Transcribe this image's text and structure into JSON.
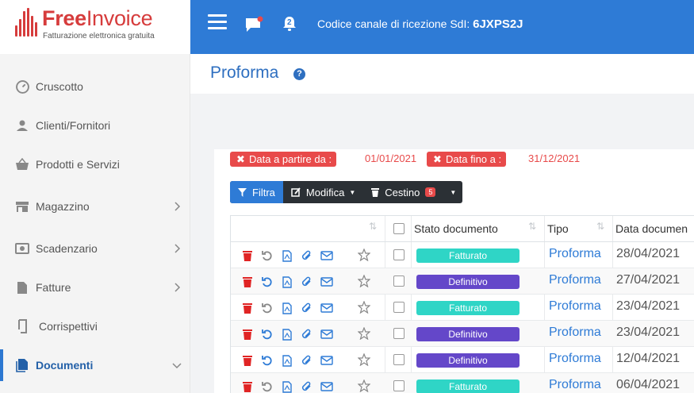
{
  "logo": {
    "brand_free": "Free",
    "brand_invoice": "Invoice",
    "tagline": "Fatturazione elettronica gratuita"
  },
  "topbar": {
    "channel_label": "Codice canale di ricezione SdI:",
    "channel_code": "6JXPS2J",
    "notification_count": "2"
  },
  "sidebar": {
    "items": [
      {
        "label": "Cruscotto",
        "icon": "dashboard-icon"
      },
      {
        "label": "Clienti/Fornitori",
        "icon": "user-icon"
      },
      {
        "label": "Prodotti e Servizi",
        "icon": "basket-icon"
      },
      {
        "label": "Magazzino",
        "icon": "store-icon"
      },
      {
        "label": "Scadenzario",
        "icon": "money-icon"
      },
      {
        "label": "Fatture",
        "icon": "file-icon"
      },
      {
        "label": "Corrispettivi",
        "icon": "receipt-icon"
      },
      {
        "label": "Documenti",
        "icon": "documents-icon"
      }
    ]
  },
  "page": {
    "title": "Proforma"
  },
  "filters": {
    "from_label": "Data a partire da :",
    "from_value": "01/01/2021",
    "to_label": "Data fino a :",
    "to_value": "31/12/2021"
  },
  "toolbar": {
    "filter": "Filtra",
    "edit": "Modifica",
    "trash": "Cestino",
    "trash_count": "5"
  },
  "table": {
    "columns": {
      "status": "Stato documento",
      "type": "Tipo",
      "date": "Data documen"
    },
    "rows": [
      {
        "status": "Fatturato",
        "type": "Proforma",
        "date": "28/04/2021"
      },
      {
        "status": "Definitivo",
        "type": "Proforma",
        "date": "27/04/2021"
      },
      {
        "status": "Fatturato",
        "type": "Proforma",
        "date": "23/04/2021"
      },
      {
        "status": "Definitivo",
        "type": "Proforma",
        "date": "23/04/2021"
      },
      {
        "status": "Definitivo",
        "type": "Proforma",
        "date": "12/04/2021"
      },
      {
        "status": "Fatturato",
        "type": "Proforma",
        "date": "06/04/2021"
      }
    ]
  },
  "colors": {
    "fatturato": "#2fd5c6",
    "definitivo": "#6447c9",
    "primary": "#2e7bd6",
    "danger": "#e84a4a"
  }
}
